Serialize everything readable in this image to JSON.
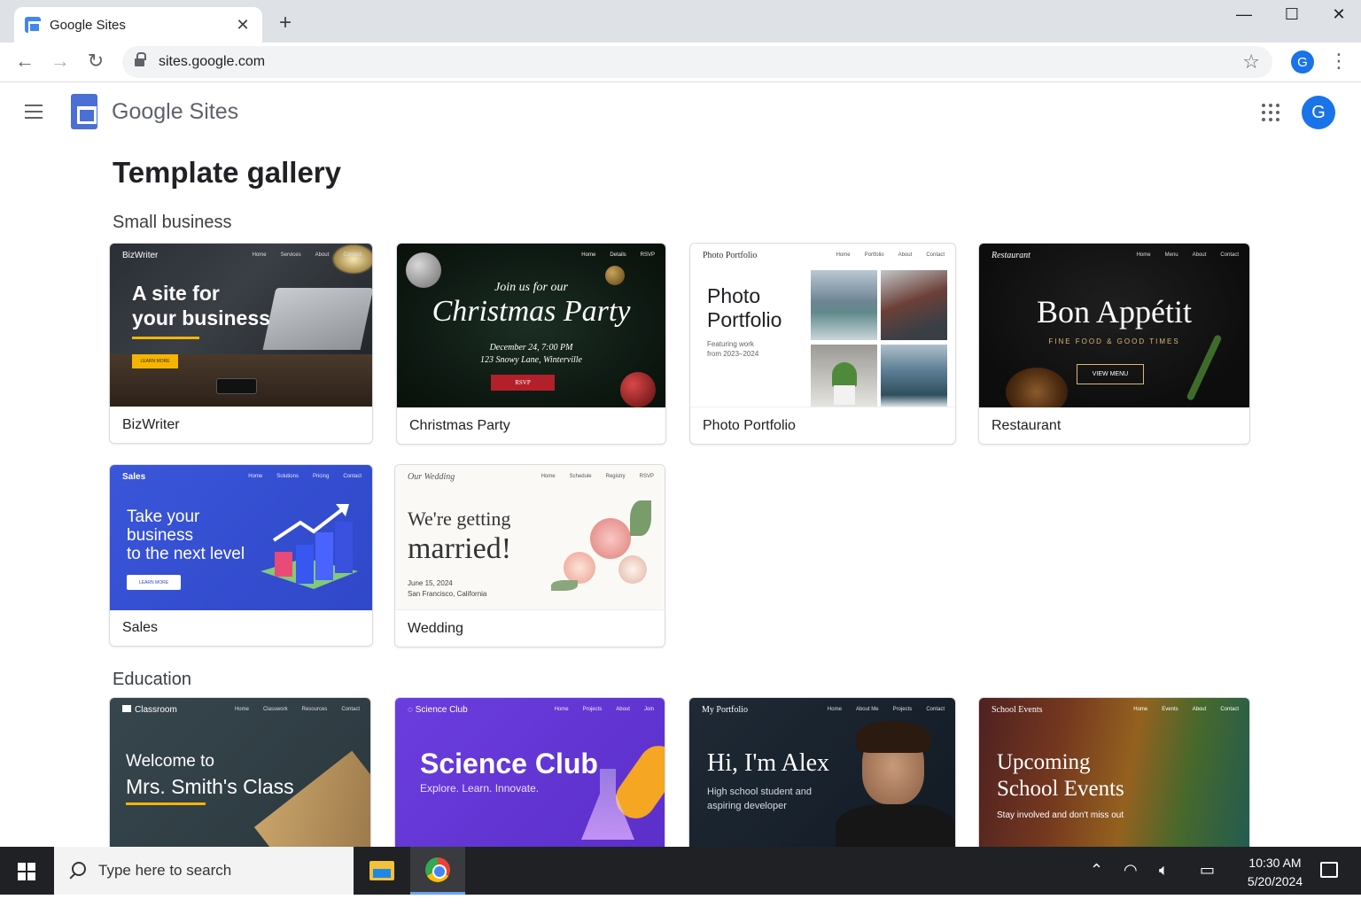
{
  "browser": {
    "tab_title": "Google Sites",
    "url": "sites.google.com",
    "profile_initial": "G"
  },
  "app": {
    "product_name": "Google Sites",
    "profile_initial": "G"
  },
  "page": {
    "title": "Template gallery"
  },
  "sections": {
    "small_business": {
      "title": "Small business",
      "templates": {
        "bizwriter": {
          "label": "BizWriter",
          "brand": "BizWriter",
          "nav": [
            "Home",
            "Services",
            "About",
            "Contact"
          ],
          "headline_1": "A site for",
          "headline_2": "your business",
          "cta": "LEARN MORE"
        },
        "christmas": {
          "label": "Christmas Party",
          "nav": [
            "Home",
            "Details",
            "RSVP"
          ],
          "intro": "Join us for our",
          "headline": "Christmas Party",
          "date": "December 24, 7:00 PM",
          "address": "123 Snowy Lane, Winterville",
          "cta": "RSVP"
        },
        "photo": {
          "label": "Photo Portfolio",
          "brand": "Photo Portfolio",
          "nav": [
            "Home",
            "Portfolio",
            "About",
            "Contact"
          ],
          "headline_1": "Photo",
          "headline_2": "Portfolio",
          "sub_1": "Featuring work",
          "sub_2": "from 2023–2024"
        },
        "restaurant": {
          "label": "Restaurant",
          "brand": "Restaurant",
          "nav": [
            "Home",
            "Menu",
            "About",
            "Contact"
          ],
          "headline": "Bon Appétit",
          "tagline": "FINE FOOD & GOOD TIMES",
          "cta": "VIEW MENU"
        },
        "sales": {
          "label": "Sales",
          "brand": "Sales",
          "nav": [
            "Home",
            "Solutions",
            "Pricing",
            "Contact"
          ],
          "headline_1": "Take your",
          "headline_2": "business",
          "headline_3": "to the next level",
          "cta": "LEARN MORE"
        },
        "wedding": {
          "label": "Wedding",
          "brand": "Our Wedding",
          "nav": [
            "Home",
            "Schedule",
            "Registry",
            "RSVP"
          ],
          "headline_1": "We're getting",
          "headline_2": "married!",
          "date": "June 15, 2024",
          "place": "San Francisco, California"
        }
      }
    },
    "education": {
      "title": "Education",
      "templates": {
        "classroom": {
          "brand": "Classroom",
          "nav": [
            "Home",
            "Classwork",
            "Resources",
            "Contact"
          ],
          "headline_1": "Welcome to",
          "headline_2": "Mrs. Smith's Class"
        },
        "science": {
          "brand": "Science Club",
          "nav": [
            "Home",
            "Projects",
            "About",
            "Join"
          ],
          "headline": "Science Club",
          "sub": "Explore. Learn. Innovate."
        },
        "portfolio": {
          "brand": "My Portfolio",
          "nav": [
            "Home",
            "About Me",
            "Projects",
            "Contact"
          ],
          "headline": "Hi, I'm Alex",
          "sub_1": "High school student and",
          "sub_2": "aspiring developer"
        },
        "school_events": {
          "brand": "School Events",
          "nav": [
            "Home",
            "Events",
            "About",
            "Contact"
          ],
          "headline_1": "Upcoming",
          "headline_2": "School Events",
          "sub": "Stay involved and don't miss out"
        }
      }
    }
  },
  "taskbar": {
    "search_placeholder": "Type here to search",
    "time": "10:30 AM",
    "date": "5/20/2024"
  },
  "colors": {
    "accent_blue": "#1a73e8",
    "sites_logo": "#4b6fd4",
    "gold": "#f5b400"
  }
}
